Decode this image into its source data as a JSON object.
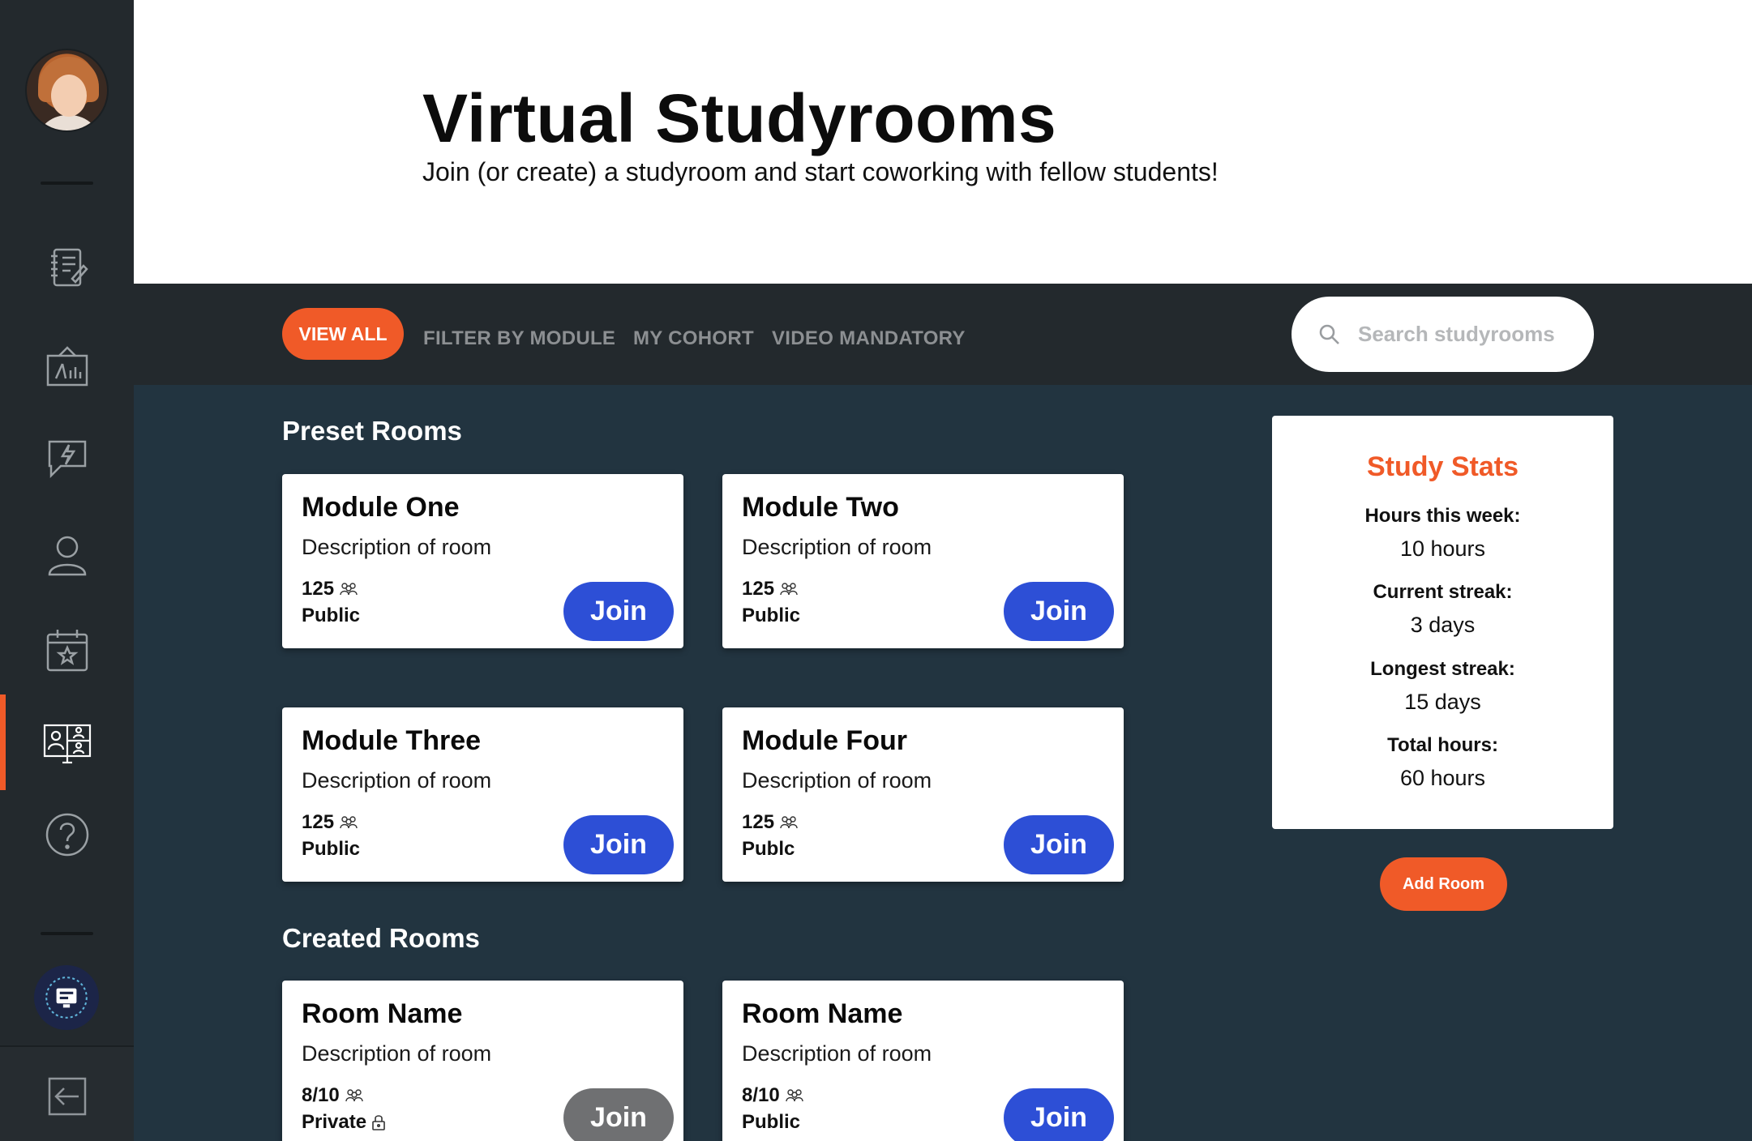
{
  "header": {
    "title": "Virtual Studyrooms",
    "subtitle": "Join (or create) a studyroom and start coworking with fellow students!"
  },
  "sidebar": {
    "icons": [
      "notebook-icon",
      "whiteboard-chart-icon",
      "lightning-chat-icon",
      "user-icon",
      "calendar-star-icon",
      "studyroom-monitor-icon",
      "help-icon",
      "badge-icon",
      "logout-icon"
    ],
    "active_item": "studyroom-monitor-icon"
  },
  "filters": {
    "view_all": "VIEW ALL",
    "by_module": "FILTER BY MODULE",
    "my_cohort": "MY COHORT",
    "video_mandatory": "VIDEO MANDATORY",
    "search_placeholder": "Search studyrooms"
  },
  "preset": {
    "title": "Preset Rooms",
    "rooms": [
      {
        "name": "Module One",
        "description": "Description of room",
        "count": "125",
        "visibility": "Public",
        "join": "Join"
      },
      {
        "name": "Module Two",
        "description": "Description of room",
        "count": "125",
        "visibility": "Public",
        "join": "Join"
      },
      {
        "name": "Module Three",
        "description": "Description of room",
        "count": "125",
        "visibility": "Public",
        "join": "Join"
      },
      {
        "name": "Module Four",
        "description": "Description of room",
        "count": "125",
        "visibility": "Publc",
        "join": "Join"
      }
    ]
  },
  "created": {
    "title": "Created Rooms",
    "rooms": [
      {
        "name": "Room Name",
        "description": "Description of room",
        "count": "8/10",
        "visibility": "Private",
        "join": "Join",
        "locked": true
      },
      {
        "name": "Room Name",
        "description": "Description of room",
        "count": "8/10",
        "visibility": "Public",
        "join": "Join",
        "locked": false
      }
    ]
  },
  "stats": {
    "title": "Study Stats",
    "items": [
      {
        "label": "Hours this week:",
        "value": "10 hours"
      },
      {
        "label": "Current streak:",
        "value": "3 days"
      },
      {
        "label": "Longest streak:",
        "value": "15 days"
      },
      {
        "label": "Total hours:",
        "value": "60 hours"
      }
    ]
  },
  "add_room": "Add Room",
  "colors": {
    "accent": "#f05a28",
    "primary_button": "#2d4fd6",
    "disabled_button": "#6f7072",
    "sidebar_bg": "#23292d",
    "main_bg": "#223440"
  }
}
